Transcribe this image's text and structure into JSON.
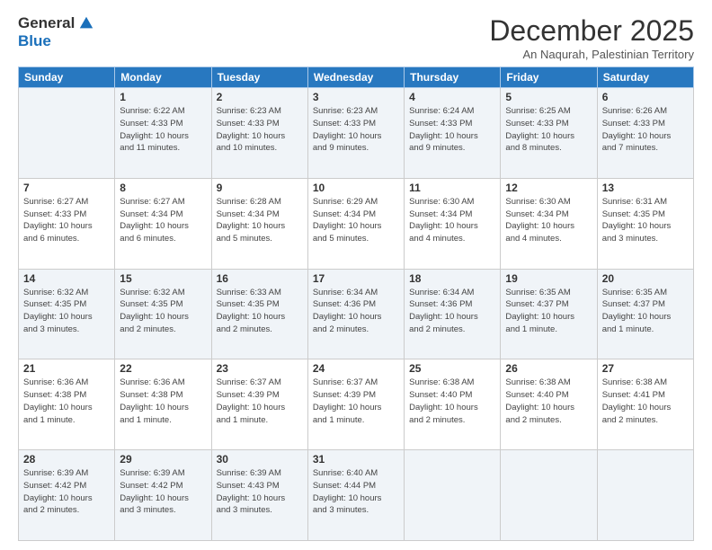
{
  "logo": {
    "general": "General",
    "blue": "Blue"
  },
  "title": "December 2025",
  "subtitle": "An Naqurah, Palestinian Territory",
  "days_header": [
    "Sunday",
    "Monday",
    "Tuesday",
    "Wednesday",
    "Thursday",
    "Friday",
    "Saturday"
  ],
  "weeks": [
    [
      {
        "day": "",
        "info": ""
      },
      {
        "day": "1",
        "info": "Sunrise: 6:22 AM\nSunset: 4:33 PM\nDaylight: 10 hours\nand 11 minutes."
      },
      {
        "day": "2",
        "info": "Sunrise: 6:23 AM\nSunset: 4:33 PM\nDaylight: 10 hours\nand 10 minutes."
      },
      {
        "day": "3",
        "info": "Sunrise: 6:23 AM\nSunset: 4:33 PM\nDaylight: 10 hours\nand 9 minutes."
      },
      {
        "day": "4",
        "info": "Sunrise: 6:24 AM\nSunset: 4:33 PM\nDaylight: 10 hours\nand 9 minutes."
      },
      {
        "day": "5",
        "info": "Sunrise: 6:25 AM\nSunset: 4:33 PM\nDaylight: 10 hours\nand 8 minutes."
      },
      {
        "day": "6",
        "info": "Sunrise: 6:26 AM\nSunset: 4:33 PM\nDaylight: 10 hours\nand 7 minutes."
      }
    ],
    [
      {
        "day": "7",
        "info": "Sunrise: 6:27 AM\nSunset: 4:33 PM\nDaylight: 10 hours\nand 6 minutes."
      },
      {
        "day": "8",
        "info": "Sunrise: 6:27 AM\nSunset: 4:34 PM\nDaylight: 10 hours\nand 6 minutes."
      },
      {
        "day": "9",
        "info": "Sunrise: 6:28 AM\nSunset: 4:34 PM\nDaylight: 10 hours\nand 5 minutes."
      },
      {
        "day": "10",
        "info": "Sunrise: 6:29 AM\nSunset: 4:34 PM\nDaylight: 10 hours\nand 5 minutes."
      },
      {
        "day": "11",
        "info": "Sunrise: 6:30 AM\nSunset: 4:34 PM\nDaylight: 10 hours\nand 4 minutes."
      },
      {
        "day": "12",
        "info": "Sunrise: 6:30 AM\nSunset: 4:34 PM\nDaylight: 10 hours\nand 4 minutes."
      },
      {
        "day": "13",
        "info": "Sunrise: 6:31 AM\nSunset: 4:35 PM\nDaylight: 10 hours\nand 3 minutes."
      }
    ],
    [
      {
        "day": "14",
        "info": "Sunrise: 6:32 AM\nSunset: 4:35 PM\nDaylight: 10 hours\nand 3 minutes."
      },
      {
        "day": "15",
        "info": "Sunrise: 6:32 AM\nSunset: 4:35 PM\nDaylight: 10 hours\nand 2 minutes."
      },
      {
        "day": "16",
        "info": "Sunrise: 6:33 AM\nSunset: 4:35 PM\nDaylight: 10 hours\nand 2 minutes."
      },
      {
        "day": "17",
        "info": "Sunrise: 6:34 AM\nSunset: 4:36 PM\nDaylight: 10 hours\nand 2 minutes."
      },
      {
        "day": "18",
        "info": "Sunrise: 6:34 AM\nSunset: 4:36 PM\nDaylight: 10 hours\nand 2 minutes."
      },
      {
        "day": "19",
        "info": "Sunrise: 6:35 AM\nSunset: 4:37 PM\nDaylight: 10 hours\nand 1 minute."
      },
      {
        "day": "20",
        "info": "Sunrise: 6:35 AM\nSunset: 4:37 PM\nDaylight: 10 hours\nand 1 minute."
      }
    ],
    [
      {
        "day": "21",
        "info": "Sunrise: 6:36 AM\nSunset: 4:38 PM\nDaylight: 10 hours\nand 1 minute."
      },
      {
        "day": "22",
        "info": "Sunrise: 6:36 AM\nSunset: 4:38 PM\nDaylight: 10 hours\nand 1 minute."
      },
      {
        "day": "23",
        "info": "Sunrise: 6:37 AM\nSunset: 4:39 PM\nDaylight: 10 hours\nand 1 minute."
      },
      {
        "day": "24",
        "info": "Sunrise: 6:37 AM\nSunset: 4:39 PM\nDaylight: 10 hours\nand 1 minute."
      },
      {
        "day": "25",
        "info": "Sunrise: 6:38 AM\nSunset: 4:40 PM\nDaylight: 10 hours\nand 2 minutes."
      },
      {
        "day": "26",
        "info": "Sunrise: 6:38 AM\nSunset: 4:40 PM\nDaylight: 10 hours\nand 2 minutes."
      },
      {
        "day": "27",
        "info": "Sunrise: 6:38 AM\nSunset: 4:41 PM\nDaylight: 10 hours\nand 2 minutes."
      }
    ],
    [
      {
        "day": "28",
        "info": "Sunrise: 6:39 AM\nSunset: 4:42 PM\nDaylight: 10 hours\nand 2 minutes."
      },
      {
        "day": "29",
        "info": "Sunrise: 6:39 AM\nSunset: 4:42 PM\nDaylight: 10 hours\nand 3 minutes."
      },
      {
        "day": "30",
        "info": "Sunrise: 6:39 AM\nSunset: 4:43 PM\nDaylight: 10 hours\nand 3 minutes."
      },
      {
        "day": "31",
        "info": "Sunrise: 6:40 AM\nSunset: 4:44 PM\nDaylight: 10 hours\nand 3 minutes."
      },
      {
        "day": "",
        "info": ""
      },
      {
        "day": "",
        "info": ""
      },
      {
        "day": "",
        "info": ""
      }
    ]
  ]
}
